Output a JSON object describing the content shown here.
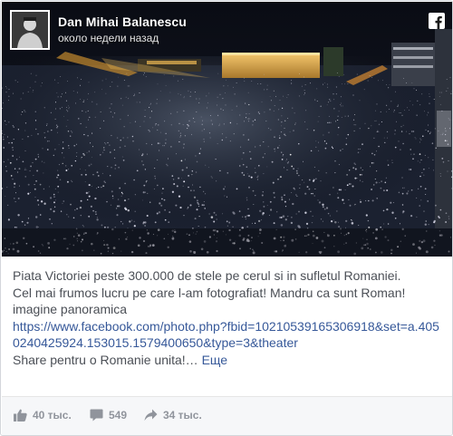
{
  "post": {
    "author_name": "Dan Mihai Balanescu",
    "timestamp": "около недели назад",
    "text_lines": [
      "Piata Victoriei peste 300.000 de stele pe cerul si in sufletul Romaniei.",
      "Cel mai frumos lucru pe care l-am fotografiat! Mandru ca sunt Roman!",
      "imagine panoramica"
    ],
    "link_text": "https://www.facebook.com/photo.php?fbid=10210539165306918&set=a.4050240425924.153015.1579400650&type=3&theater",
    "last_line": "Share pentru o Romanie unita!…",
    "more_label": "Еще",
    "likes": "40 тыс.",
    "comments": "549",
    "shares": "34 тыс."
  },
  "icons": {
    "platform": "facebook-logo-icon",
    "like": "thumbs-up-icon",
    "comment": "speech-bubble-icon",
    "share": "share-arrow-icon"
  },
  "colors": {
    "link": "#365899",
    "text": "#4b4f56",
    "stats": "#90949c",
    "footer_bg": "#f6f7f9"
  }
}
